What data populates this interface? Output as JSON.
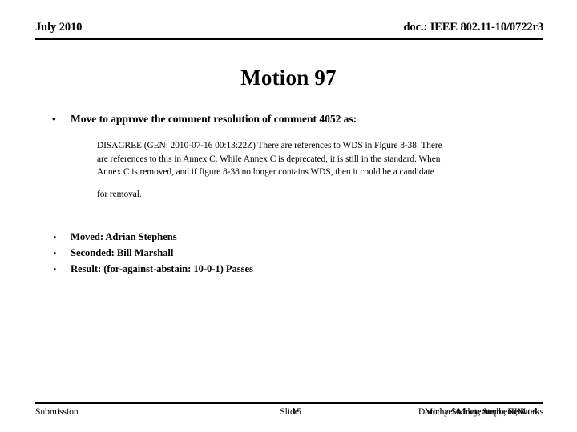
{
  "header": {
    "date": "July 2010",
    "doc_number": "doc.: IEEE 802.11-10/0722r3"
  },
  "title": "Motion 97",
  "content": {
    "motion_bullet": {
      "marker": "•",
      "text": "Move to approve the comment resolution of comment 4052 as:"
    },
    "resolution": {
      "marker": "–",
      "line1": "DISAGREE (GEN: 2010-07-16 00:13:22Z) There are references to WDS in Figure 8-38.  There",
      "line2": "are references to this in Annex C. While Annex C is deprecated, it is still in the standard.  When",
      "line3": "Annex C is removed, and if figure 8-38 no longer contains WDS, then it could be a candidate",
      "line4": "for removal."
    },
    "vote_items": [
      {
        "marker": "▪",
        "text": "Moved: Adrian Stephens"
      },
      {
        "marker": "▪",
        "text": "Seconded: Bill Marshall"
      },
      {
        "marker": "▪",
        "text": "Result: (for-against-abstain:  10-0-1) Passes"
      }
    ]
  },
  "footer": {
    "left": "Submission",
    "center_label": "Slide",
    "center_number": "15",
    "right_primary": "Dorothy Stanley, Aruba Networks",
    "right_overlay_1": "Michael Montemurro, RIM",
    "right_overlay_2": "Adrian Stephens, Intel"
  }
}
